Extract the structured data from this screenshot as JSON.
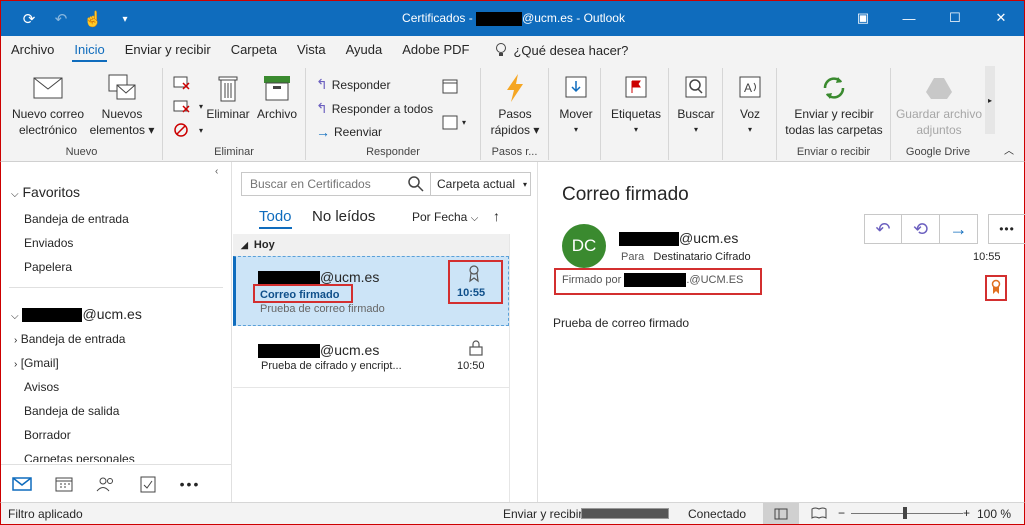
{
  "window": {
    "title_prefix": "Certificados - ",
    "title_suffix": "@ucm.es  -  Outlook"
  },
  "menu": {
    "items": [
      "Archivo",
      "Inicio",
      "Enviar y recibir",
      "Carpeta",
      "Vista",
      "Ayuda",
      "Adobe PDF"
    ],
    "tell_me": "¿Qué desea hacer?"
  },
  "ribbon": {
    "nuevo": {
      "label": "Nuevo",
      "new_mail": [
        "Nuevo correo",
        "electrónico"
      ],
      "new_items": [
        "Nuevos",
        "elementos ▾"
      ]
    },
    "eliminar": {
      "label": "Eliminar",
      "delete": "Eliminar",
      "archive": "Archivo"
    },
    "responder": {
      "label": "Responder",
      "reply": "Responder",
      "reply_all": "Responder a todos",
      "forward": "Reenviar"
    },
    "pasos": {
      "label": "Pasos r...",
      "quick": [
        "Pasos",
        "rápidos ▾"
      ]
    },
    "mover": "Mover",
    "etiquetas": "Etiquetas",
    "buscar": "Buscar",
    "voz": "Voz",
    "enviar_recibir": {
      "label": "Enviar o recibir",
      "btn": [
        "Enviar y recibir",
        "todas las carpetas"
      ]
    },
    "google": {
      "label": "Google Drive",
      "btn": [
        "Guardar archivo",
        "adjuntos"
      ]
    }
  },
  "nav": {
    "favorites_title": "Favoritos",
    "favorites": [
      "Bandeja de entrada",
      "Enviados",
      "Papelera"
    ],
    "account_suffix": "@ucm.es",
    "folders": [
      "Bandeja de entrada",
      "[Gmail]",
      "Avisos",
      "Bandeja de salida",
      "Borrador",
      "Carpetas personales"
    ]
  },
  "list": {
    "search_placeholder": "Buscar en Certificados",
    "scope": "Carpeta actual",
    "tab_all": "Todo",
    "tab_unread": "No leídos",
    "sort": "Por Fecha",
    "group_today": "Hoy",
    "messages": [
      {
        "sender_suffix": "@ucm.es",
        "subject": "Correo firmado",
        "preview": "Prueba de correo firmado",
        "time": "10:55"
      },
      {
        "sender_suffix": "@ucm.es",
        "subject": "",
        "preview": "Prueba de cifrado y encript...",
        "time": "10:50"
      }
    ]
  },
  "reading": {
    "subject": "Correo firmado",
    "avatar": "DC",
    "from_suffix": "@ucm.es",
    "to_label": "Para",
    "to_name": "Destinatario Cifrado",
    "time": "10:55",
    "signed_by_label": "Firmado por",
    "signed_by_suffix": ".@UCM.ES",
    "body": "Prueba de correo firmado"
  },
  "status": {
    "filter": "Filtro aplicado",
    "send_receive": "Enviar y recibir",
    "connected": "Conectado",
    "zoom": "100 %"
  },
  "colors": {
    "accent": "#0f6cbd",
    "avatar": "#3a8a2f",
    "highlight": "#d32f2f"
  }
}
